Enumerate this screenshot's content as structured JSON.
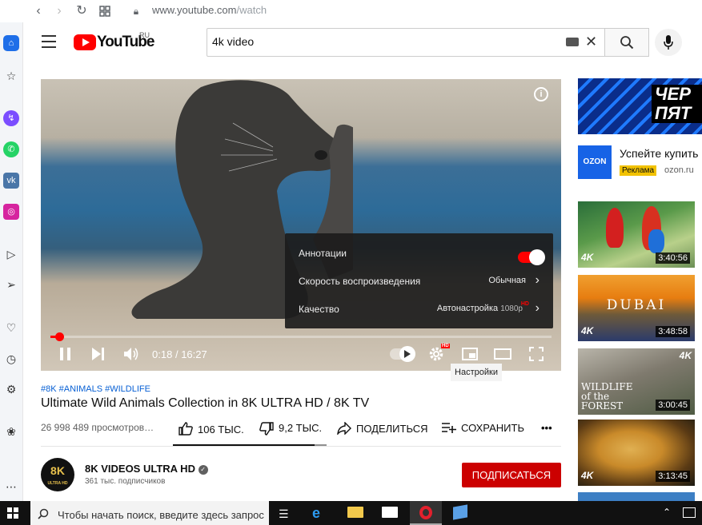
{
  "browser": {
    "url_host": "www.youtube.com",
    "url_path": "/watch"
  },
  "header": {
    "logo_text": "YouTube",
    "logo_region": "RU",
    "search_value": "4k video"
  },
  "player": {
    "time_current": "0:18",
    "time_separator": "/",
    "time_total": "16:27",
    "progress_fraction": 0.018,
    "hd_badge": "HD",
    "settings_menu": [
      {
        "label": "Аннотации",
        "value": "",
        "toggle": true
      },
      {
        "label": "Скорость воспроизведения",
        "value": "Обычная"
      },
      {
        "label": "Качество",
        "value": "Автонастройка",
        "value_suffix": "1080p",
        "value_badge": "HD"
      }
    ],
    "tooltip": "Настройки"
  },
  "video": {
    "hashtags": "#8K #ANIMALS #WILDLIFE",
    "title": "Ultimate Wild Animals Collection in 8K ULTRA HD / 8K TV",
    "views": "26 998 489 просмотров…",
    "likes": "106 ТЫС.",
    "dislikes": "9,2 ТЫС.",
    "share_label": "ПОДЕЛИТЬСЯ",
    "save_label": "СОХРАНИТЬ",
    "more_label": "•••",
    "like_fraction": 0.92
  },
  "channel": {
    "avatar_text": "8K",
    "avatar_sub": "ULTRA HD",
    "name": "8K VIDEOS ULTRA HD",
    "subscribers": "361 тыс. подписчиков",
    "subscribe_label": "ПОДПИСАТЬСЯ"
  },
  "ad": {
    "banner_text": "ЧЕР ПЯТ",
    "logo_text": "OZON",
    "headline": "Успейте купить",
    "tag": "Реклама",
    "domain": "ozon.ru"
  },
  "suggestions": [
    {
      "duration": "3:40:56",
      "badge": "4K"
    },
    {
      "duration": "3:48:58",
      "badge": "4K",
      "overlay": "DUBAI"
    },
    {
      "duration": "3:00:45",
      "badge": "4K",
      "overlay": "WILDLIFE of the FOREST"
    },
    {
      "duration": "3:13:45",
      "badge": "4K"
    }
  ],
  "taskbar": {
    "search_placeholder": "Чтобы начать поиск, введите здесь запрос"
  },
  "colors": {
    "youtube_red": "#ff0000",
    "subscribe_red": "#cc0000",
    "link_blue": "#065fd4",
    "ozon_blue": "#1763e6"
  }
}
